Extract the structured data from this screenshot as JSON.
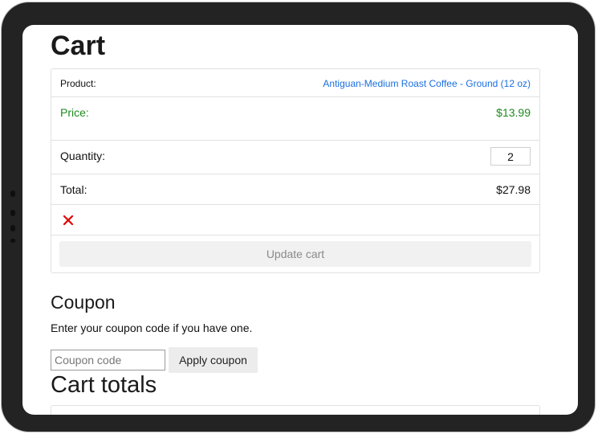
{
  "page": {
    "title": "Cart"
  },
  "cart": {
    "product_label": "Product:",
    "product_name": "Antiguan-Medium Roast Coffee - Ground (12 oz)",
    "price_label": "Price:",
    "price_value": "$13.99",
    "quantity_label": "Quantity:",
    "quantity_value": "2",
    "total_label": "Total:",
    "total_value": "$27.98",
    "remove_icon": "close-x-icon",
    "update_label": "Update cart"
  },
  "coupon": {
    "title": "Coupon",
    "description": "Enter your coupon code if you have one.",
    "placeholder": "Coupon code",
    "apply_label": "Apply coupon"
  },
  "totals": {
    "title": "Cart totals"
  },
  "colors": {
    "link": "#1a6fe0",
    "price": "#1f8a1f",
    "remove": "#e00000",
    "device_frame": "#232323"
  }
}
